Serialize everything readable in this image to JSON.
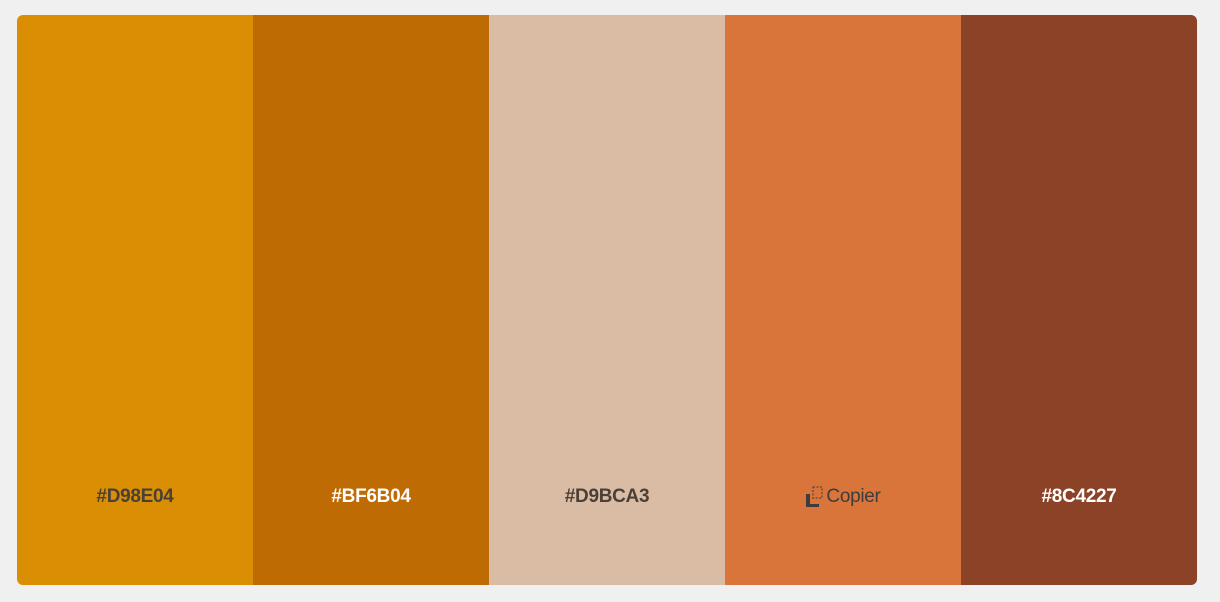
{
  "palette": {
    "swatches": [
      {
        "color": "#D98E04",
        "label": "#D98E04",
        "label_tone": "dark"
      },
      {
        "color": "#BF6B04",
        "label": "#BF6B04",
        "label_tone": "light"
      },
      {
        "color": "#D9BCA3",
        "label": "#D9BCA3",
        "label_tone": "dark"
      },
      {
        "color": "#D9743B",
        "label": "Copier",
        "label_tone": "dark",
        "hover": true,
        "icon": "copy-icon"
      },
      {
        "color": "#8C4227",
        "label": "#8C4227",
        "label_tone": "light"
      }
    ]
  }
}
